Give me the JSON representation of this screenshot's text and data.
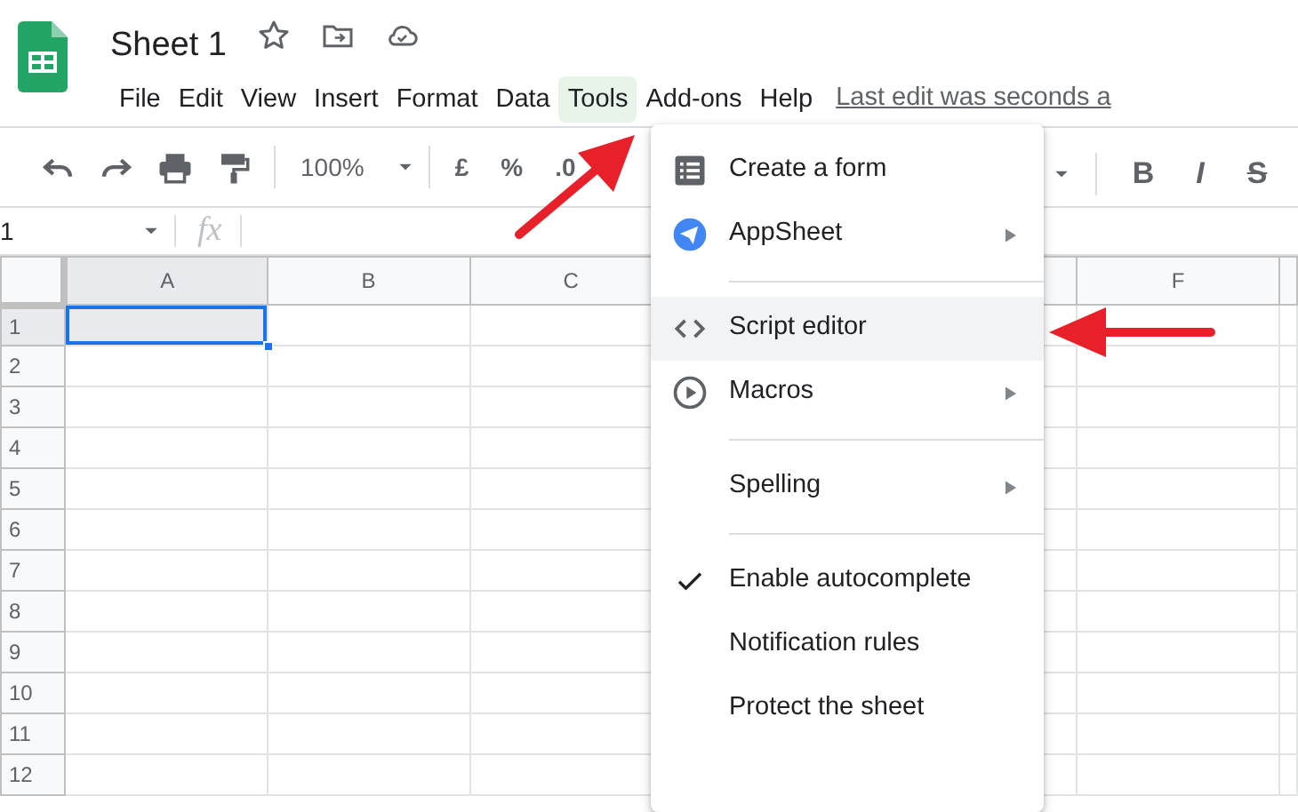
{
  "document": {
    "title": "Sheet 1"
  },
  "menubar": [
    {
      "label": "File",
      "selected": false
    },
    {
      "label": "Edit",
      "selected": false
    },
    {
      "label": "View",
      "selected": false
    },
    {
      "label": "Insert",
      "selected": false
    },
    {
      "label": "Format",
      "selected": false
    },
    {
      "label": "Data",
      "selected": false
    },
    {
      "label": "Tools",
      "selected": true
    },
    {
      "label": "Add-ons",
      "selected": false
    },
    {
      "label": "Help",
      "selected": false
    }
  ],
  "last_edit": "Last edit was seconds a",
  "toolbar": {
    "zoom": "100%",
    "left_items": [
      "£",
      "%",
      ".0"
    ],
    "right_items": [
      "B",
      "I",
      "S"
    ]
  },
  "formula_bar": {
    "cell_ref": "1",
    "fx": "fx"
  },
  "columns": [
    {
      "label": "A",
      "selected": true
    },
    {
      "label": "B",
      "selected": false
    },
    {
      "label": "C",
      "selected": false
    },
    {},
    {},
    {
      "label": "F",
      "selected": false
    }
  ],
  "rows": [
    {
      "label": "1",
      "selected": true
    },
    {
      "label": "2",
      "selected": false
    },
    {
      "label": "3",
      "selected": false
    },
    {
      "label": "4",
      "selected": false
    },
    {
      "label": "5",
      "selected": false
    },
    {
      "label": "6",
      "selected": false
    },
    {
      "label": "7",
      "selected": false
    },
    {
      "label": "8",
      "selected": false
    },
    {
      "label": "9",
      "selected": false
    },
    {
      "label": "10",
      "selected": false
    },
    {
      "label": "11",
      "selected": false
    },
    {
      "label": "12",
      "selected": false
    }
  ],
  "tools_menu": {
    "sections": [
      [
        {
          "label": "Create a form",
          "submenu": false,
          "checked": false,
          "selected": false
        },
        {
          "label": "AppSheet",
          "submenu": true,
          "checked": false,
          "selected": false
        }
      ],
      [
        {
          "label": "Script editor",
          "submenu": false,
          "checked": false,
          "selected": true
        },
        {
          "label": "Macros",
          "submenu": true,
          "checked": false,
          "selected": false
        }
      ],
      [
        {
          "label": "Spelling",
          "submenu": true,
          "checked": false,
          "selected": false
        }
      ],
      [
        {
          "label": "Enable autocomplete",
          "submenu": false,
          "checked": true,
          "selected": false
        },
        {
          "label": "Notification rules",
          "submenu": false,
          "checked": false,
          "selected": false
        },
        {
          "label": "Protect the sheet",
          "submenu": false,
          "checked": false,
          "selected": false
        }
      ]
    ]
  }
}
